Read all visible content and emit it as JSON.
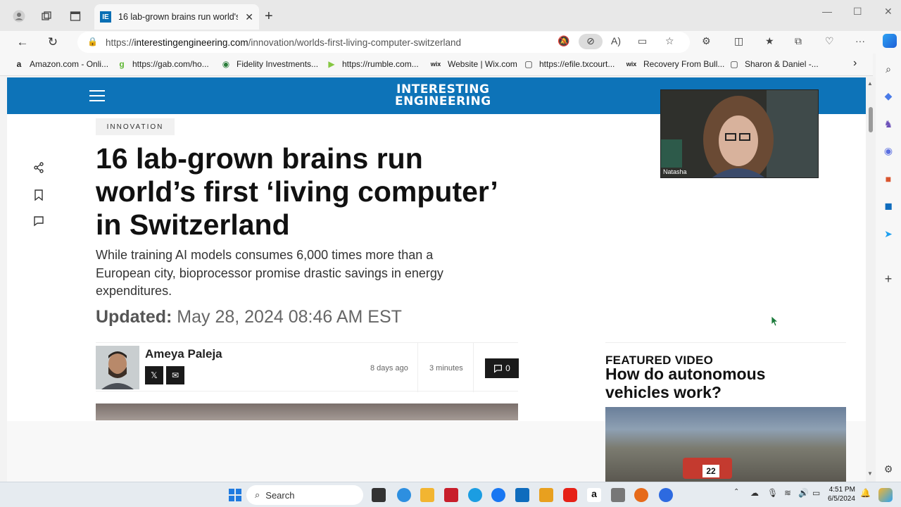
{
  "browser": {
    "tab_title": "16 lab-grown brains run world's first",
    "tab_favicon": "IE",
    "url_prefix": "https://",
    "url_host": "interestingengineering.com",
    "url_path": "/innovation/worlds-first-living-computer-switzerland"
  },
  "bookmarks": [
    {
      "icon": "a",
      "label": "Amazon.com - Onli..."
    },
    {
      "icon": "g",
      "label": "https://gab.com/ho..."
    },
    {
      "icon": "◉",
      "label": "Fidelity Investments..."
    },
    {
      "icon": "▶",
      "label": "https://rumble.com..."
    },
    {
      "icon": "wix",
      "label": "Website | Wix.com"
    },
    {
      "icon": "▢",
      "label": "https://efile.txcourt..."
    },
    {
      "icon": "wix",
      "label": "Recovery From Bull..."
    },
    {
      "icon": "▢",
      "label": "Sharon & Daniel -..."
    }
  ],
  "site": {
    "logo_line1": "INTERESTING",
    "logo_line2": "ENGINEERING"
  },
  "article": {
    "category": "INNOVATION",
    "headline": "16 lab-grown brains run world’s first ‘living computer’ in Switzerland",
    "subhead": "While training AI models consumes 6,000 times more than a European city, bioprocessor promise drastic savings in energy expenditures.",
    "updated_label": "Updated:",
    "updated_value": "May 28, 2024 08:46 AM EST",
    "author": "Ameya Paleja",
    "posted": "8 days ago",
    "read_time": "3 minutes",
    "comment_count": "0"
  },
  "webcam": {
    "name": "Natasha"
  },
  "featured": {
    "label": "FEATURED VIDEO",
    "title": "How do autonomous vehicles work?",
    "badge": "22"
  },
  "taskbar": {
    "search_label": "Search",
    "time": "4:51 PM",
    "date": "6/5/2024"
  }
}
